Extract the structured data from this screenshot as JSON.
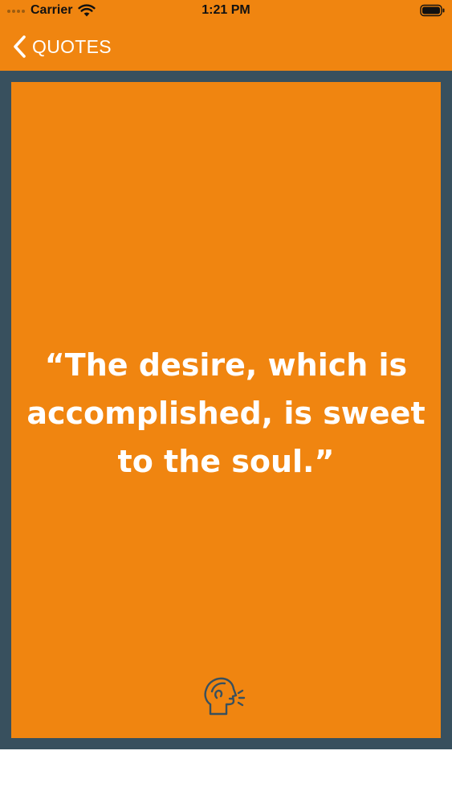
{
  "status_bar": {
    "carrier": "Carrier",
    "time": "1:21 PM",
    "icons": [
      "signal-dots-icon",
      "wifi-icon",
      "battery-icon"
    ]
  },
  "nav": {
    "back_icon": "chevron-left-icon",
    "back_label": "QUOTES"
  },
  "quote": {
    "text": "“The desire, which is accomplished, is sweet to the soul.”"
  },
  "footer_icon": "speaking-head-icon",
  "colors": {
    "accent": "#F08510",
    "frame": "#38505E",
    "text": "#FFFFFF",
    "icon": "#38505E"
  }
}
